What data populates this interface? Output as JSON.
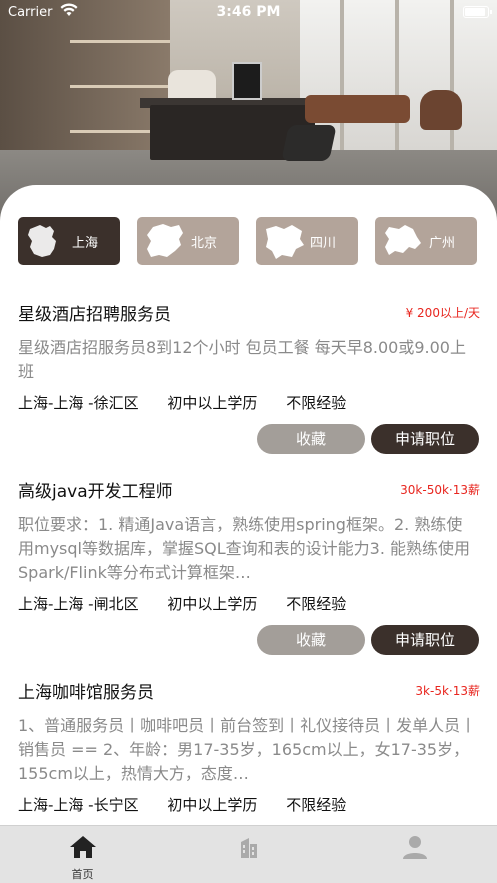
{
  "status_bar": {
    "carrier": "Carrier",
    "time": "3:46 PM"
  },
  "cities": [
    {
      "name": "上海",
      "active": true
    },
    {
      "name": "北京",
      "active": false
    },
    {
      "name": "四川",
      "active": false
    },
    {
      "name": "广州",
      "active": false
    }
  ],
  "jobs": [
    {
      "title": "星级酒店招聘服务员",
      "salary": "¥ 200以上/天",
      "description": "星级酒店招服务员8到12个小时 包员工餐 每天早8.00或9.00上班",
      "location": "上海-上海 -徐汇区",
      "education": "初中以上学历",
      "experience": "不限经验",
      "favorite_label": "收藏",
      "apply_label": "申请职位"
    },
    {
      "title": "高级java开发工程师",
      "salary": "30k-50k·13薪",
      "description": "职位要求：1. 精通Java语言，熟练使用spring框架。2. 熟练使用mysql等数据库，掌握SQL查询和表的设计能力3. 能熟练使用Spark/Flink等分布式计算框架…",
      "location": "上海-上海 -闸北区",
      "education": "初中以上学历",
      "experience": "不限经验",
      "favorite_label": "收藏",
      "apply_label": "申请职位"
    },
    {
      "title": "上海咖啡馆服务员",
      "salary": "3k-5k·13薪",
      "description": "1、普通服务员丨咖啡吧员丨前台签到丨礼仪接待员丨发单人员丨销售员 == 2、年龄：男17-35岁，165cm以上，女17-35岁，155cm以上，热情大方，态度…",
      "location": "上海-上海 -长宁区",
      "education": "初中以上学历",
      "experience": "不限经验"
    }
  ],
  "tabbar": {
    "tabs": [
      {
        "label": "首页",
        "icon": "home-icon",
        "active": true
      },
      {
        "label": "",
        "icon": "building-icon",
        "active": false
      },
      {
        "label": "",
        "icon": "person-icon",
        "active": false
      }
    ]
  },
  "colors": {
    "accent_dark": "#3b302b",
    "chip_inactive": "#b3a49a",
    "salary_red": "#e8261f",
    "fav_button": "#a39e99"
  }
}
